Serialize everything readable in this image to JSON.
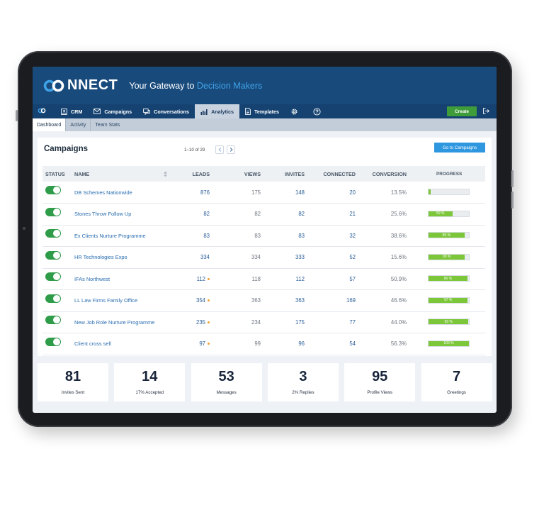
{
  "brand": {
    "logo_text": "NNECT",
    "tagline_prefix": "Your Gateway to",
    "tagline_highlight": "Decision Makers"
  },
  "nav": {
    "items": [
      {
        "id": "crm",
        "label": "CRM",
        "icon": "person-card-icon"
      },
      {
        "id": "campaigns",
        "label": "Campaigns",
        "icon": "envelope-icon"
      },
      {
        "id": "conversations",
        "label": "Conversations",
        "icon": "chat-icon"
      },
      {
        "id": "analytics",
        "label": "Analytics",
        "icon": "bar-chart-icon",
        "active": true
      },
      {
        "id": "templates",
        "label": "Templates",
        "icon": "document-icon"
      }
    ],
    "create_label": "Create"
  },
  "subnav": {
    "items": [
      "Dashboard",
      "Activity",
      "Team Stats"
    ],
    "active": "Dashboard"
  },
  "campaigns": {
    "title": "Campaigns",
    "pager": "1–10 of 29",
    "goto_label": "Go to Campaigns",
    "columns": {
      "status": "STATUS",
      "name": "NAME",
      "leads": "LEADS",
      "views": "VIEWS",
      "invites": "INVITES",
      "connected": "CONNECTED",
      "conversion": "CONVERSION",
      "progress": "PROGRESS"
    },
    "rows": [
      {
        "name": "DB Schemes Nationwide",
        "leads": "876",
        "views": "175",
        "invites": "148",
        "connected": "20",
        "conversion": "13.5%",
        "progress": 5,
        "progress_label": "",
        "warn": false
      },
      {
        "name": "Stones Throw Follow Up",
        "leads": "82",
        "views": "82",
        "invites": "82",
        "connected": "21",
        "conversion": "25.6%",
        "progress": 59,
        "progress_label": "59 %",
        "warn": false
      },
      {
        "name": "Ex Clients Nurture Programme",
        "leads": "83",
        "views": "83",
        "invites": "83",
        "connected": "32",
        "conversion": "38.6%",
        "progress": 89,
        "progress_label": "89 %",
        "warn": false
      },
      {
        "name": "HR Technologies Expo",
        "leads": "334",
        "views": "334",
        "invites": "333",
        "connected": "52",
        "conversion": "15.6%",
        "progress": 90,
        "progress_label": "90 %",
        "warn": false
      },
      {
        "name": "IFAs Northwest",
        "leads": "112",
        "views": "118",
        "invites": "112",
        "connected": "57",
        "conversion": "50.9%",
        "progress": 96,
        "progress_label": "96 %",
        "warn": true
      },
      {
        "name": "LL Law Firms Family Office",
        "leads": "354",
        "views": "363",
        "invites": "363",
        "connected": "169",
        "conversion": "46.6%",
        "progress": 97,
        "progress_label": "97 %",
        "warn": true
      },
      {
        "name": "New Job Role Nurture Programme",
        "leads": "235",
        "views": "234",
        "invites": "175",
        "connected": "77",
        "conversion": "44.0%",
        "progress": 99,
        "progress_label": "99 %",
        "warn": true
      },
      {
        "name": "Client cross sell",
        "leads": "97",
        "views": "99",
        "invites": "96",
        "connected": "54",
        "conversion": "56.3%",
        "progress": 100,
        "progress_label": "100 %",
        "warn": true
      }
    ]
  },
  "stats": [
    {
      "value": "81",
      "label": "Invites Sent"
    },
    {
      "value": "14",
      "label": "17% Accepted"
    },
    {
      "value": "53",
      "label": "Messages"
    },
    {
      "value": "3",
      "label": "2% Replies"
    },
    {
      "value": "95",
      "label": "Profile Views"
    },
    {
      "value": "7",
      "label": "Greetings"
    }
  ],
  "colors": {
    "banner": "#184a7c",
    "accent": "#3fa2e6",
    "toggle_on": "#2e9c48",
    "progress": "#7cc63a",
    "create": "#3f9c3b"
  }
}
